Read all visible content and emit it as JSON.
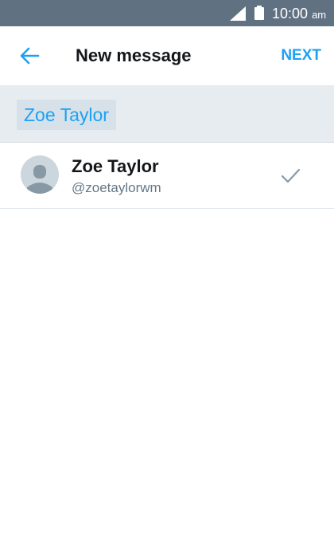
{
  "status_bar": {
    "time": "10:00",
    "ampm": "am",
    "icons": [
      "signal-icon",
      "battery-icon"
    ]
  },
  "header": {
    "back_icon": "arrow-left-icon",
    "title": "New message",
    "next_label": "NEXT"
  },
  "recipients": {
    "selected": [
      "Zoe Taylor"
    ]
  },
  "results": [
    {
      "name": "Zoe Taylor",
      "handle": "@zoetaylorwm",
      "selected": true,
      "avatar_icon": "default-avatar-icon",
      "check_icon": "checkmark-icon"
    }
  ],
  "colors": {
    "status_bar": "#607182",
    "accent": "#1da1f2",
    "recipient_bg": "#e6ecf0",
    "chip_bg": "#d6e1ea",
    "text_primary": "#14171a",
    "text_secondary": "#657786"
  }
}
